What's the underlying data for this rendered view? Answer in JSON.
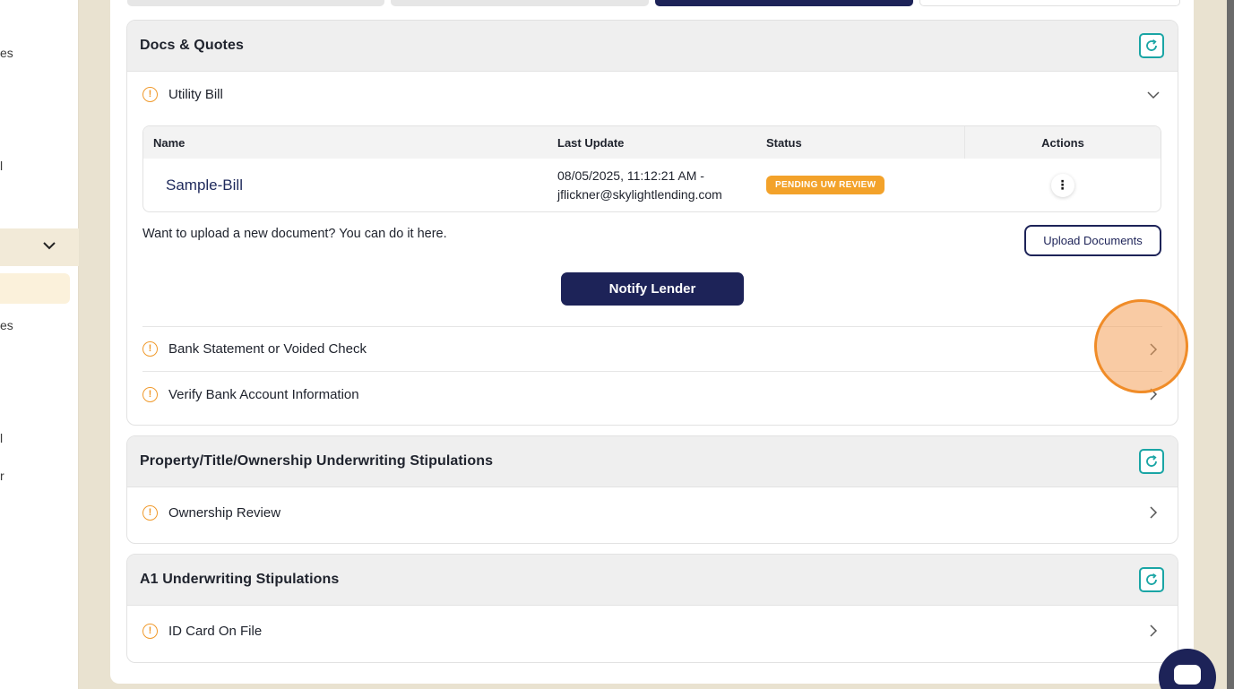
{
  "sidebar": {
    "fragments": [
      "es",
      "l",
      "es",
      "l",
      "r"
    ]
  },
  "sections": {
    "docs": {
      "title": "Docs & Quotes",
      "open_item": {
        "label": "Utility Bill",
        "table": {
          "headers": [
            "Name",
            "Last Update",
            "Status",
            "Actions"
          ],
          "rows": [
            {
              "name": "Sample-Bill",
              "last_update_line1": "08/05/2025, 11:12:21 AM -",
              "last_update_line2": "jflickner@skylightlending.com",
              "status": "PENDING UW REVIEW"
            }
          ]
        },
        "upload_prompt": "Want to upload a new document? You can do it here.",
        "upload_button": "Upload Documents",
        "notify_button": "Notify Lender"
      },
      "items": [
        {
          "label": "Bank Statement or Voided Check"
        },
        {
          "label": "Verify Bank Account Information"
        }
      ]
    },
    "property": {
      "title": "Property/Title/Ownership Underwriting Stipulations",
      "items": [
        {
          "label": "Ownership Review"
        }
      ]
    },
    "a1": {
      "title": "A1 Underwriting Stipulations",
      "items": [
        {
          "label": "ID Card On File"
        }
      ]
    }
  },
  "colors": {
    "navy": "#1d2358",
    "warning": "#f09a2c",
    "teal": "#1aa5a5",
    "badge": "#f3a22a"
  }
}
